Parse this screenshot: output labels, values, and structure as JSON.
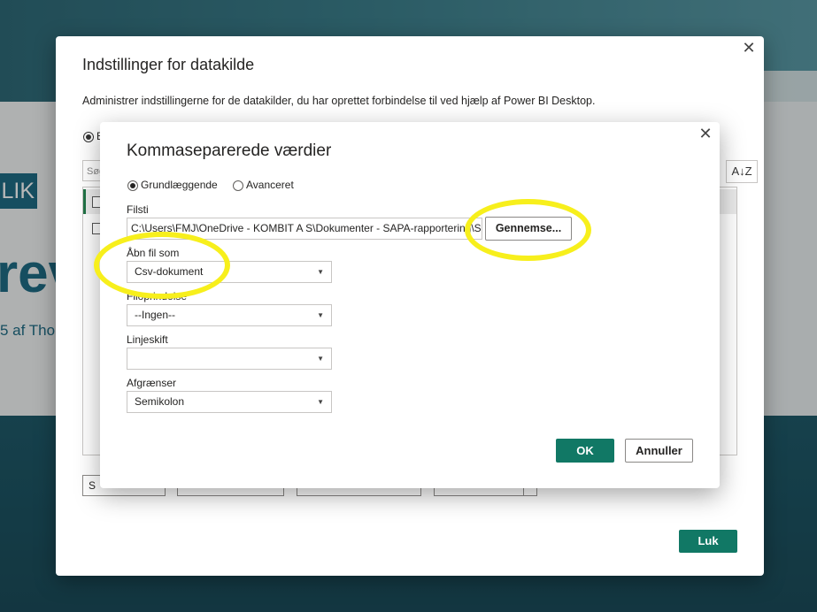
{
  "background": {
    "logo_text": "LIK",
    "big_text": "rev",
    "small_text": "5 af Tho"
  },
  "outer_dialog": {
    "title": "Indstillinger for datakilde",
    "description": "Administrer indstillingerne for de datakilder, du har oprettet forbindelse til ved hjælp af Power BI Desktop.",
    "radio_label": "E",
    "search_placeholder": "Søg",
    "sort_icon": "A↓Z",
    "buttons": [
      "S",
      "",
      "",
      "",
      ""
    ],
    "close_label": "Luk",
    "close_icon": "✕"
  },
  "inner_dialog": {
    "title": "Kommaseparerede værdier",
    "close_icon": "✕",
    "mode_basic": "Grundlæggende",
    "mode_advanced": "Avanceret",
    "filepath_label": "Filsti",
    "filepath_value": "C:\\Users\\FMJ\\OneDrive - KOMBIT A S\\Dokumenter - SAPA-rapportering\\S",
    "browse_label": "Gennemse...",
    "open_as_label": "Åbn fil som",
    "open_as_value": "Csv-dokument",
    "origin_label": "Filoprindelse",
    "origin_value": "--Ingen--",
    "linebreak_label": "Linjeskift",
    "linebreak_value": "",
    "delimiter_label": "Afgrænser",
    "delimiter_value": "Semikolon",
    "ok_label": "OK",
    "cancel_label": "Annuller"
  },
  "colors": {
    "accent": "#117865",
    "highlight": "#f7ef1c"
  }
}
